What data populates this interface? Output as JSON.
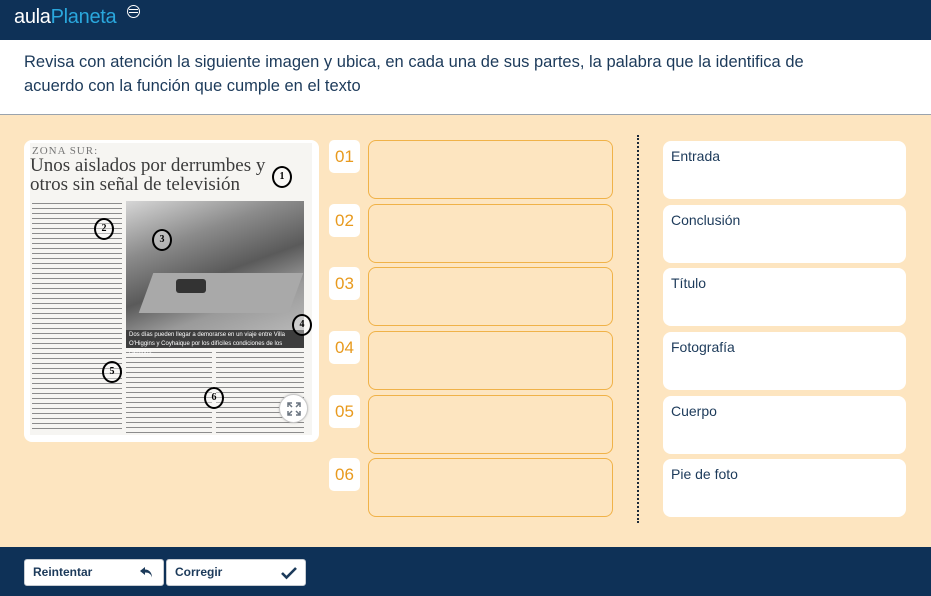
{
  "header": {
    "brand_part1": "aula",
    "brand_part2": "Planeta"
  },
  "instructions": "Revisa con atención la siguiente imagen y ubica, en cada una de sus partes, la palabra que la identifica de acuerdo con la función que cumple en el texto",
  "newspaper": {
    "kicker": "ZONA SUR:",
    "headline": "Unos aislados por derrumbes y otros sin señal de televisión",
    "caption": "Dos días pueden llegar a demorarse en un viaje entre Villa O'Higgins y Coyhaique por los difíciles condiciones de los caminos.",
    "markers": [
      "1",
      "2",
      "3",
      "4",
      "5",
      "6"
    ]
  },
  "slots": [
    {
      "number": "01"
    },
    {
      "number": "02"
    },
    {
      "number": "03"
    },
    {
      "number": "04"
    },
    {
      "number": "05"
    },
    {
      "number": "06"
    }
  ],
  "words": [
    "Entrada",
    "Conclusión",
    "Título",
    "Fotografía",
    "Cuerpo",
    "Pie de foto"
  ],
  "footer": {
    "retry_label": "Reintentar",
    "check_label": "Corregir"
  },
  "colors": {
    "header_bg": "#0e3157",
    "stage_bg": "#fde5c0",
    "accent": "#e89a1e",
    "brand_light": "#2aa7dd"
  }
}
